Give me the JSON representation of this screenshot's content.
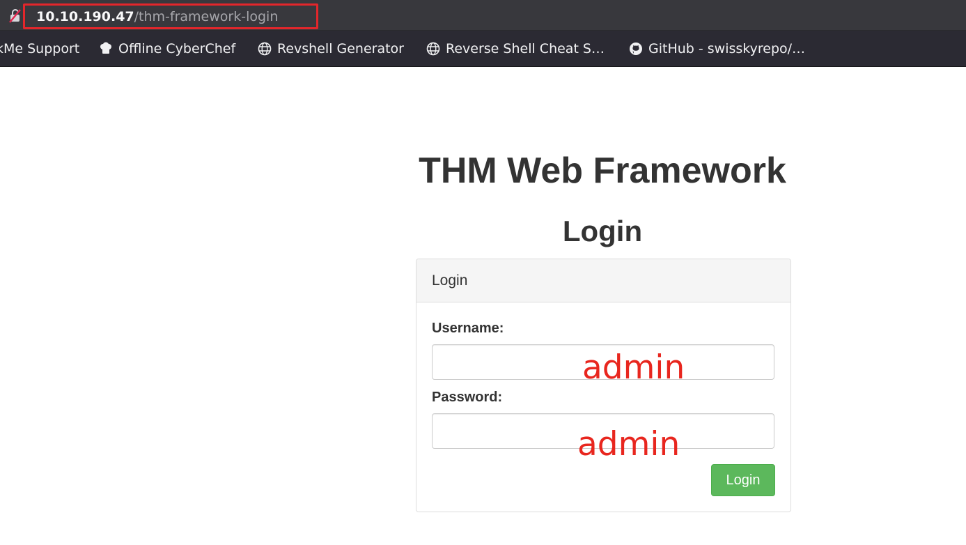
{
  "browser": {
    "url_host": "10.10.190.47",
    "url_path": "/thm-framework-login",
    "highlight_color": "#e3262b",
    "bookmarks": [
      {
        "label": "kMe Support",
        "icon": "none"
      },
      {
        "label": "Offline CyberChef",
        "icon": "chef-hat-icon"
      },
      {
        "label": "Revshell Generator",
        "icon": "globe-icon"
      },
      {
        "label": "Reverse Shell Cheat S…",
        "icon": "globe-icon"
      },
      {
        "label": "GitHub - swisskyrepo/…",
        "icon": "github-icon"
      }
    ]
  },
  "page": {
    "title": "THM Web Framework",
    "subtitle": "Login",
    "panel": {
      "heading": "Login",
      "username_label": "Username:",
      "username_value": "",
      "password_label": "Password:",
      "password_value": "",
      "submit_label": "Login",
      "submit_color": "#5cb85c"
    }
  },
  "annotations": {
    "username_hint": "admin",
    "password_hint": "admin",
    "color": "#e8261e"
  }
}
